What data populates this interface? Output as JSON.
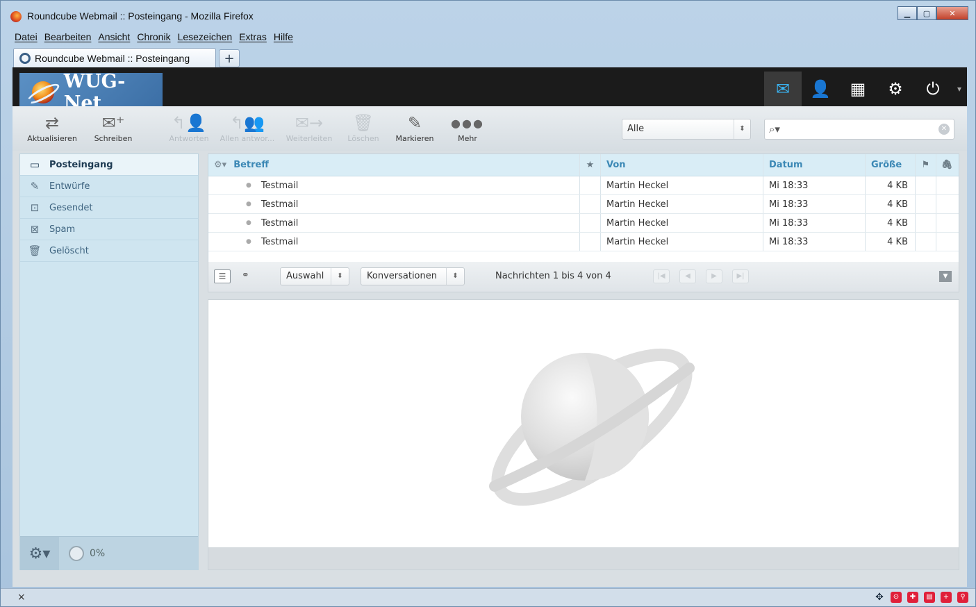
{
  "window": {
    "title": "Roundcube Webmail :: Posteingang - Mozilla Firefox",
    "controls": [
      "minimize",
      "maximize",
      "close"
    ]
  },
  "menubar": [
    "Datei",
    "Bearbeiten",
    "Ansicht",
    "Chronik",
    "Lesezeichen",
    "Extras",
    "Hilfe"
  ],
  "tabs": [
    {
      "label": "Roundcube Webmail :: Posteingang"
    }
  ],
  "newtab_label": "+",
  "app": {
    "logo_text": "WUG-Net",
    "topnav": [
      {
        "name": "mail-icon",
        "glyph": "✉"
      },
      {
        "name": "contacts-icon",
        "glyph": "👤"
      },
      {
        "name": "calendar-icon",
        "glyph": "▦"
      },
      {
        "name": "settings-icon",
        "glyph": "⚙"
      },
      {
        "name": "logout-icon",
        "glyph": "⏻"
      }
    ],
    "toolbar": {
      "refresh": "Aktualisieren",
      "compose": "Schreiben",
      "reply": "Antworten",
      "reply_all": "Allen antwor...",
      "forward": "Weiterleiten",
      "delete": "Löschen",
      "mark": "Markieren",
      "more": "Mehr",
      "filter_value": "Alle",
      "search_value": ""
    },
    "folders": [
      {
        "label": "Posteingang",
        "icon": "inbox-icon",
        "glyph": "▭",
        "selected": true
      },
      {
        "label": "Entwürfe",
        "icon": "pencil-icon",
        "glyph": "✎",
        "selected": false
      },
      {
        "label": "Gesendet",
        "icon": "sent-icon",
        "glyph": "⊡",
        "selected": false
      },
      {
        "label": "Spam",
        "icon": "spam-icon",
        "glyph": "⊠",
        "selected": false
      },
      {
        "label": "Gelöscht",
        "icon": "trash-icon",
        "glyph": "🗑",
        "selected": false
      }
    ],
    "quota": "0%",
    "columns": {
      "subject": "Betreff",
      "from": "Von",
      "date": "Datum",
      "size": "Größe"
    },
    "messages": [
      {
        "subject": "Testmail",
        "from": "Martin Heckel",
        "date": "Mi 18:33",
        "size": "4 KB"
      },
      {
        "subject": "Testmail",
        "from": "Martin Heckel",
        "date": "Mi 18:33",
        "size": "4 KB"
      },
      {
        "subject": "Testmail",
        "from": "Martin Heckel",
        "date": "Mi 18:33",
        "size": "4 KB"
      },
      {
        "subject": "Testmail",
        "from": "Martin Heckel",
        "date": "Mi 18:33",
        "size": "4 KB"
      }
    ],
    "listfooter": {
      "select_value": "Auswahl",
      "threads_value": "Konversationen",
      "count_text": "Nachrichten 1 bis 4 von 4"
    }
  },
  "statusbar": {
    "close_glyph": "×"
  },
  "colors": {
    "header_bg": "#1b1b1b",
    "accent": "#3ab4f2",
    "folder_bg": "#cfe5f0",
    "list_header": "#d9edf6"
  }
}
